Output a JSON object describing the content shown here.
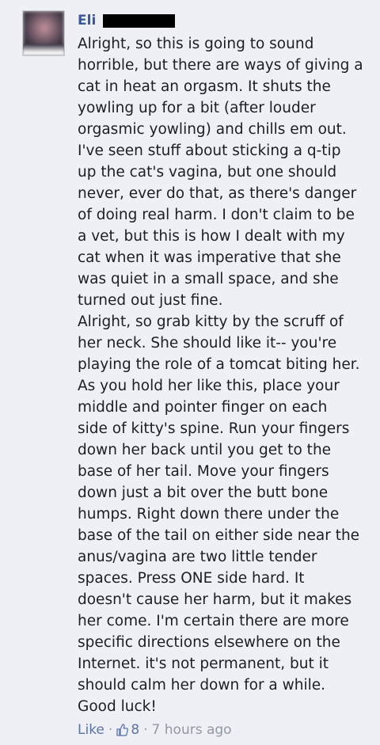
{
  "comment": {
    "author": "Eli",
    "paragraphs": [
      "Alright, so this is going to sound\nhorrible, but there are ways of giving a\ncat in heat an orgasm. It shuts the\nyowling up for a bit (after louder\norgasmic yowling) and chills em out.\nI've seen stuff about sticking a q-tip\nup the cat's vagina, but one should\nnever, ever do that, as there's danger\nof doing real harm. I don't claim to be\na vet, but this is how I dealt with my\ncat when it was imperative that she\nwas quiet in a small space, and she\nturned out just fine.",
      "Alright, so grab kitty by the scruff of\nher neck. She should like it-- you're\nplaying the role of a tomcat biting her.\nAs you hold her like this, place your\nmiddle and pointer finger on each\nside of kitty's spine. Run your fingers\ndown her back until you get to the\nbase of her tail. Move your fingers\ndown just a bit over the butt bone\nhumps. Right down there under the\nbase of the tail on either side near the\nanus/vagina are two little tender\nspaces. Press ONE side hard. It\ndoesn't cause her harm, but it makes\nher come. I'm certain there are more\nspecific directions elsewhere on the\nInternet. it's not permanent, but it\nshould calm her down for a while.\nGood luck!"
    ],
    "footer": {
      "like_label": "Like",
      "separator": "·",
      "like_count": "8",
      "timestamp": "7 hours ago",
      "like_icon": "thumbs-up-icon"
    }
  },
  "colors": {
    "background": "#eef0f5",
    "link": "#3b5998",
    "text": "#1c1e21",
    "meta": "#9197a3"
  }
}
